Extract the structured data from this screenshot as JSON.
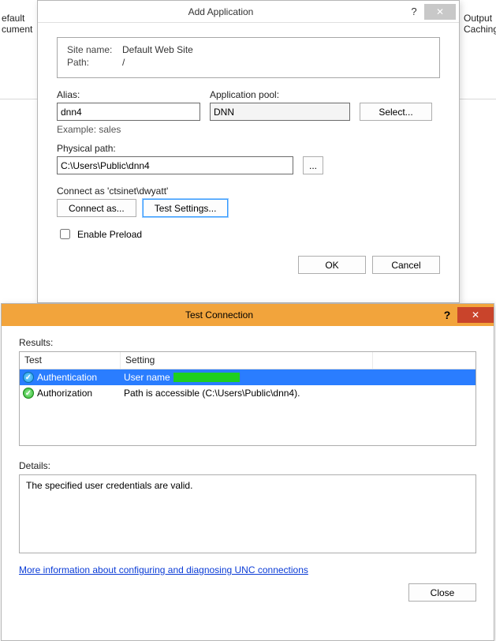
{
  "bg": {
    "left1": "efault",
    "left2": "cument",
    "right1": "Output",
    "right2": "Caching"
  },
  "add": {
    "title": "Add Application",
    "help": "?",
    "close_x": "✕",
    "site_name_label": "Site name:",
    "site_name": "Default Web Site",
    "path_label": "Path:",
    "path": "/",
    "alias_label": "Alias:",
    "alias": "dnn4",
    "apppool_label": "Application pool:",
    "apppool": "DNN",
    "select": "Select...",
    "example": "Example: sales",
    "physical_label": "Physical path:",
    "physical": "C:\\Users\\Public\\dnn4",
    "browse": "...",
    "connect_label": "Connect as 'ctsinet\\dwyatt'",
    "connect_as": "Connect as...",
    "test_settings": "Test Settings...",
    "enable_preload": "Enable Preload",
    "ok": "OK",
    "cancel": "Cancel"
  },
  "test": {
    "title": "Test Connection",
    "help": "?",
    "close_x": "✕",
    "results_label": "Results:",
    "col_test": "Test",
    "col_setting": "Setting",
    "rows": [
      {
        "test": "Authentication",
        "setting": "User name "
      },
      {
        "test": "Authorization",
        "setting": "Path is accessible (C:\\Users\\Public\\dnn4)."
      }
    ],
    "details_label": "Details:",
    "details": "The specified user credentials are valid.",
    "link": "More information about configuring and diagnosing UNC connections",
    "close": "Close"
  }
}
